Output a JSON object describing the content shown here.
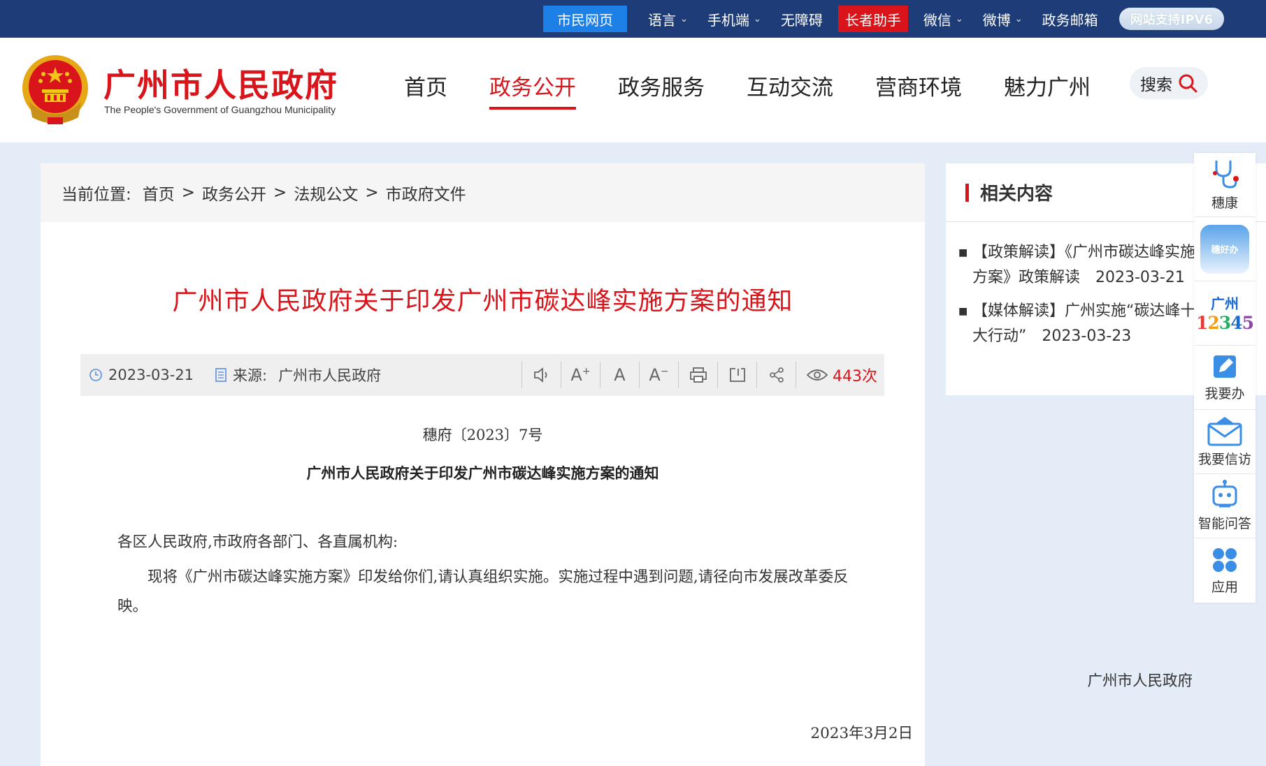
{
  "topbar": {
    "citizen": "市民网页",
    "language": "语言",
    "mobile": "手机端",
    "accessible": "无障碍",
    "elder": "长者助手",
    "wechat": "微信",
    "weibo": "微博",
    "mail": "政务邮箱",
    "ipv6": "网站支持IPV6"
  },
  "header": {
    "site_name": "广州市人民政府",
    "site_sub": "The People's Government of Guangzhou Municipality",
    "nav": [
      "首页",
      "政务公开",
      "政务服务",
      "互动交流",
      "营商环境",
      "魅力广州"
    ],
    "active_nav": "政务公开",
    "search": "搜索"
  },
  "breadcrumb": {
    "label": "当前位置:",
    "items": [
      "首页",
      "政务公开",
      "法规公文",
      "市政府文件"
    ],
    "sep": ">"
  },
  "article": {
    "title": "广州市人民政府关于印发广州市碳达峰实施方案的通知",
    "date": "2023-03-21",
    "source_label": "来源:",
    "source": "广州市人民政府",
    "views": "443次",
    "docnum": "穗府〔2023〕7号",
    "subtitle": "广州市人民政府关于印发广州市碳达峰实施方案的通知",
    "salutation": "各区人民政府,市政府各部门、各直属机构:",
    "para1": "现将《广州市碳达峰实施方案》印发给你们,请认真组织实施。实施过程中遇到问题,请径向市发展改革委反映。",
    "signer": "广州市人民政府",
    "sign_date": "2023年3月2日"
  },
  "related": {
    "title": "相关内容",
    "items": [
      "【政策解读】《广州市碳达峰实施方案》政策解读　2023-03-21",
      "【媒体解读】广州实施“碳达峰十大行动”　2023-03-23"
    ]
  },
  "sidepanel": {
    "items": [
      "穗康",
      "穗好办",
      "广州",
      "12345",
      "我要办",
      "我要信访",
      "智能问答",
      "应用"
    ]
  },
  "colors": {
    "brand_red": "#d9151b",
    "topbar_blue": "#1e3d78",
    "citizen_blue": "#1c80e6"
  }
}
